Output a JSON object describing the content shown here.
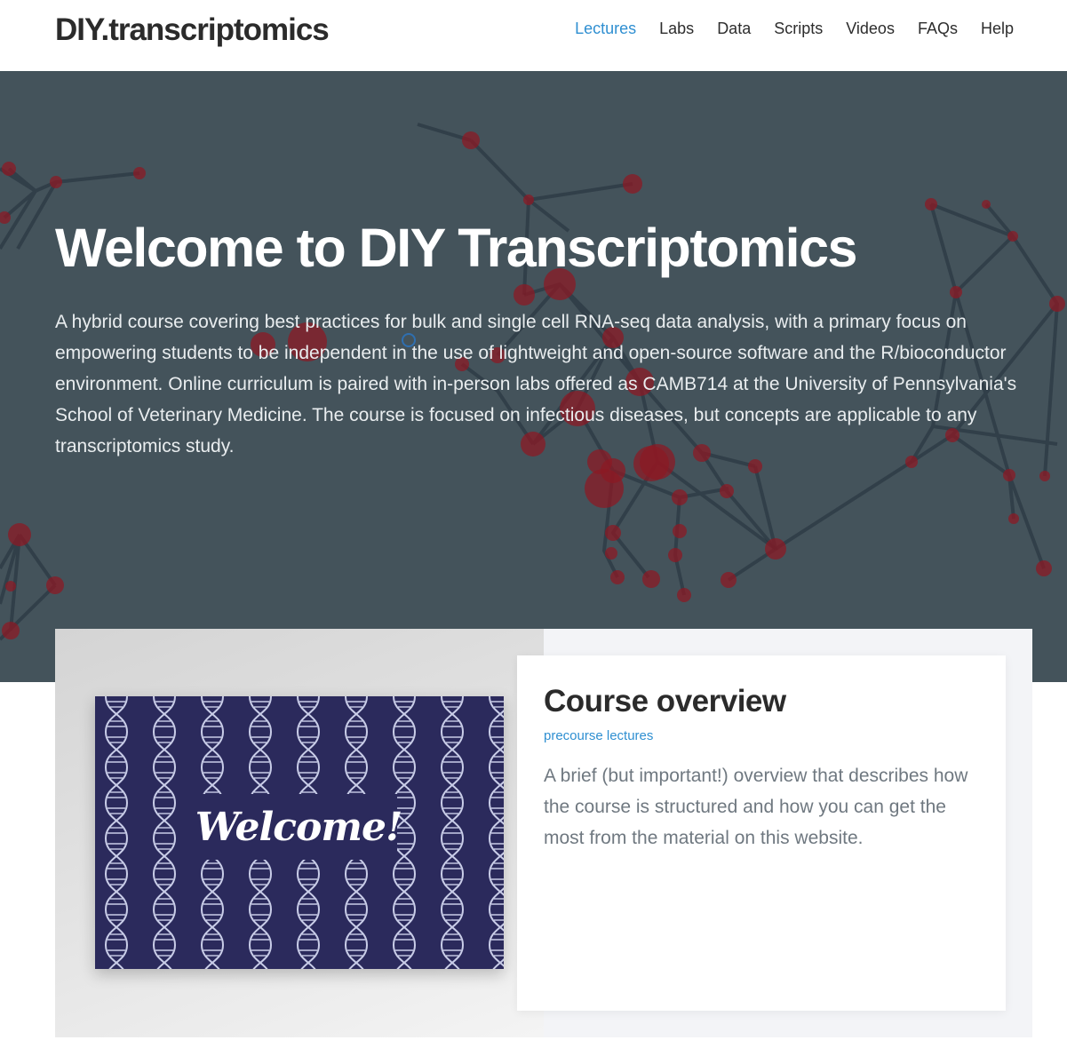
{
  "header": {
    "brand": "DIY.transcriptomics",
    "nav": [
      {
        "label": "Lectures",
        "active": true
      },
      {
        "label": "Labs",
        "active": false
      },
      {
        "label": "Data",
        "active": false
      },
      {
        "label": "Scripts",
        "active": false
      },
      {
        "label": "Videos",
        "active": false
      },
      {
        "label": "FAQs",
        "active": false
      },
      {
        "label": "Help",
        "active": false
      }
    ]
  },
  "hero": {
    "title": "Welcome to DIY Transcriptomics",
    "description": "A hybrid course covering best practices for bulk and single cell RNA-seq data analysis, with a primary focus on empowering students to be independent in the use of lightweight and open-source software and the R/bioconductor environment. Online curriculum is paired with in-person labs offered as CAMB714 at the University of Pennsylvania's School of Veterinary Medicine. The course is focused on infectious diseases, but concepts are applicable to any transcriptomics study."
  },
  "card": {
    "image_text": "Welcome!",
    "title": "Course overview",
    "tag": "precourse lectures",
    "text": "A brief (but important!) overview that describes how the course is structured and how you can get the most from the material on this website."
  },
  "colors": {
    "accent": "#2f8fd1",
    "hero_bg": "#44535b",
    "node": "#8b1a24",
    "image_bg": "#2b2a5c"
  }
}
